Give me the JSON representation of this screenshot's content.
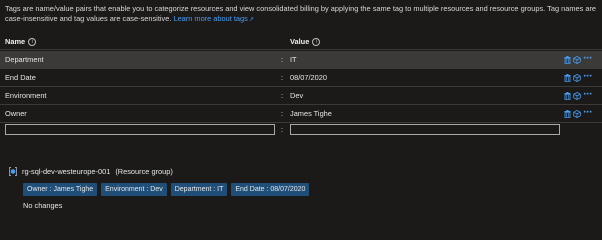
{
  "description": {
    "text": "Tags are name/value pairs that enable you to categorize resources and view consolidated billing by applying the same tag to multiple resources and resource groups. Tag names are case-insensitive and tag values are case-sensitive.",
    "link": "Learn more about tags"
  },
  "columns": {
    "name": "Name",
    "value": "Value"
  },
  "tags": [
    {
      "name": "Department",
      "colon": ":",
      "value": "IT"
    },
    {
      "name": "End Date",
      "colon": ":",
      "value": "08/07/2020"
    },
    {
      "name": "Environment",
      "colon": ":",
      "value": "Dev"
    },
    {
      "name": "Owner",
      "colon": ":",
      "value": "James Tighe"
    }
  ],
  "new_tag": {
    "colon": ":",
    "name_value": "",
    "value_value": ""
  },
  "resource": {
    "name": "rg-sql-dev-westeurope-001",
    "type": "(Resource group)",
    "chips": [
      "Owner : James Tighe",
      "Environment : Dev",
      "Department : IT",
      "End Date : 08/07/2020"
    ],
    "status": "No changes"
  },
  "colors": {
    "accent": "#479ef5",
    "chip_bg": "#1f4e79",
    "selected_row": "#3b3a39"
  }
}
